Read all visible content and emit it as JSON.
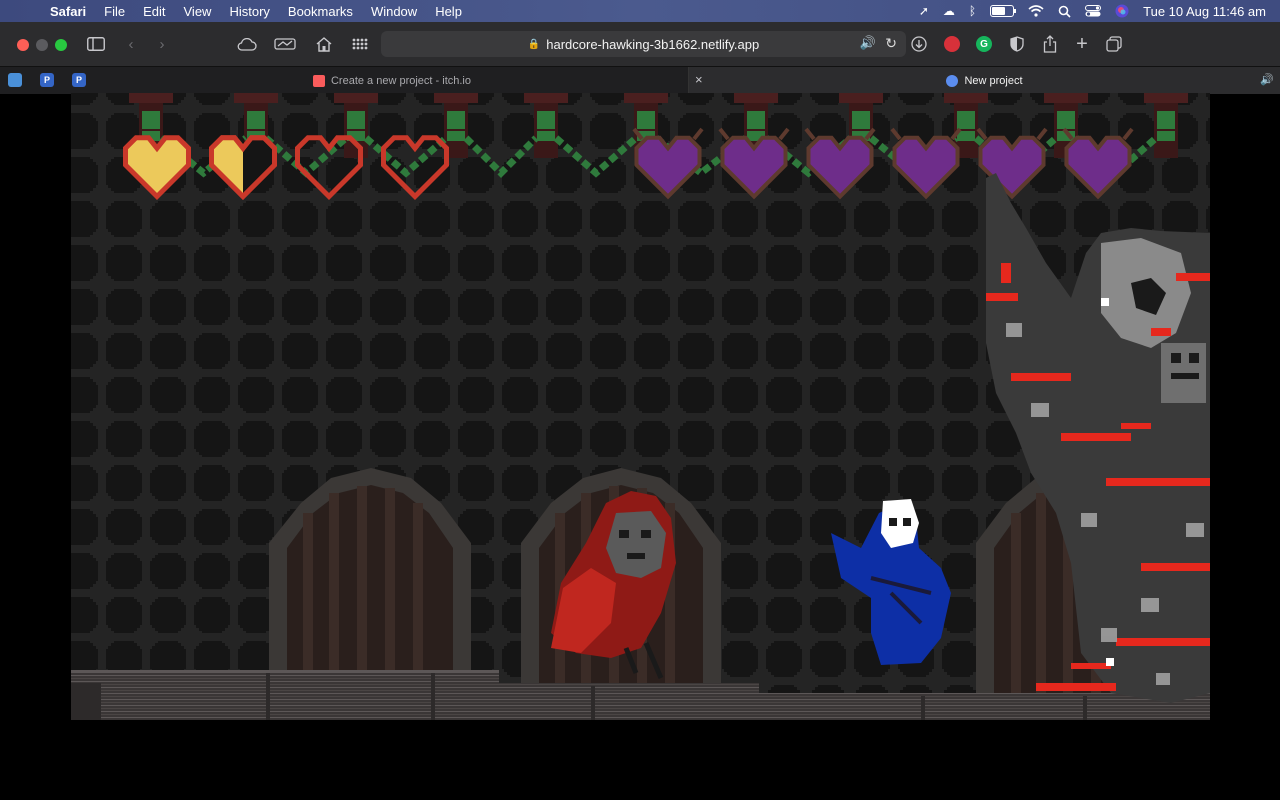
{
  "menubar": {
    "apple": "",
    "items": [
      "Safari",
      "File",
      "Edit",
      "View",
      "History",
      "Bookmarks",
      "Window",
      "Help"
    ],
    "clock": "Tue 10 Aug  11:46 am",
    "battery_level": 0.7,
    "status_icons": [
      "location-arrow-icon",
      "cloud-icon",
      "bluetooth-icon",
      "battery-icon",
      "wifi-icon",
      "search-icon",
      "control-center-icon",
      "siri-icon"
    ]
  },
  "toolbar": {
    "url": "hardcore-hawking-3b1662.netlify.app",
    "icons": [
      "sidebar-icon",
      "back-icon",
      "forward-icon",
      "icloud-tabs-icon",
      "reading-list-icon",
      "home-icon",
      "grid-icon",
      "download-icon",
      "share-icon",
      "new-tab-icon",
      "tab-overview-icon"
    ],
    "extensions": [
      {
        "name": "opera-icon",
        "color": "#d8313a",
        "letter": ""
      },
      {
        "name": "grammarly-icon",
        "color": "#16b55c",
        "letter": "G"
      },
      {
        "name": "privacy-shield-icon",
        "color": "#8e8e93",
        "letter": ""
      }
    ]
  },
  "tabs": [
    {
      "title": "Create a new project - itch.io",
      "active": false,
      "favicon_color": "#fa5c5c"
    },
    {
      "title": "New project",
      "active": true,
      "favicon_color": "#5b8def"
    }
  ],
  "pinned_tabs": [
    {
      "letter": "",
      "color": "#4a90d9"
    },
    {
      "letter": "P",
      "color": "#3465c6"
    },
    {
      "letter": "P",
      "color": "#3465c6"
    }
  ],
  "game": {
    "player_health": {
      "full": 1,
      "half": 1,
      "empty": 2,
      "max": 4
    },
    "boss_health": {
      "hearts": 6
    },
    "colors": {
      "player_heart": "#ecc95b",
      "heart_outline": "#c9382a",
      "boss_heart": "#6e2d8a",
      "boss_outline": "#5e3a2e",
      "vine": "#2f7a3c",
      "wall_grid": "#242424",
      "door_frame": "#3b3836",
      "door_planks": "#2a1f1c",
      "floor": "#4a4544",
      "hero_cloak": "#0d2fa6",
      "owl_red": "#b3211c",
      "skeleton": "#5a5a5a",
      "lava": "#e6281d"
    },
    "entities": [
      "player-knight",
      "red-owl-enemy",
      "skeleton-boss"
    ]
  }
}
